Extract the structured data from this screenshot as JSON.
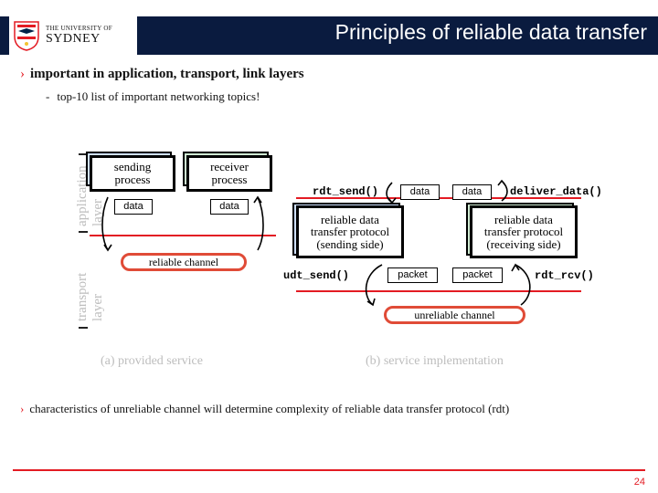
{
  "logo": {
    "small": "THE UNIVERSITY OF",
    "big": "SYDNEY"
  },
  "title": "Principles of reliable data transfer",
  "bullet1": "important in application, transport, link layers",
  "bullet2": "top-10 list of important networking topics!",
  "labels": {
    "app_layer": "application\nlayer",
    "transport_layer": "transport\nlayer",
    "sending_process": "sending\nprocess",
    "receiver_process": "receiver\nprocess",
    "reliable_channel": "reliable channel",
    "unreliable_channel": "unreliable channel",
    "rdt_send_proto": "reliable data\ntransfer protocol\n(sending side)",
    "rdt_recv_proto": "reliable data\ntransfer protocol\n(receiving side)",
    "data": "data",
    "packet": "packet",
    "rdt_send": "rdt_send()",
    "udt_send": "udt_send()",
    "deliver_data": "deliver_data()",
    "rdt_rcv": "rdt_rcv()",
    "caption_a": "(a)  provided service",
    "caption_b": "(b) service implementation"
  },
  "note": "characteristics of unreliable channel will determine complexity of reliable data transfer protocol (rdt)",
  "page": "24"
}
